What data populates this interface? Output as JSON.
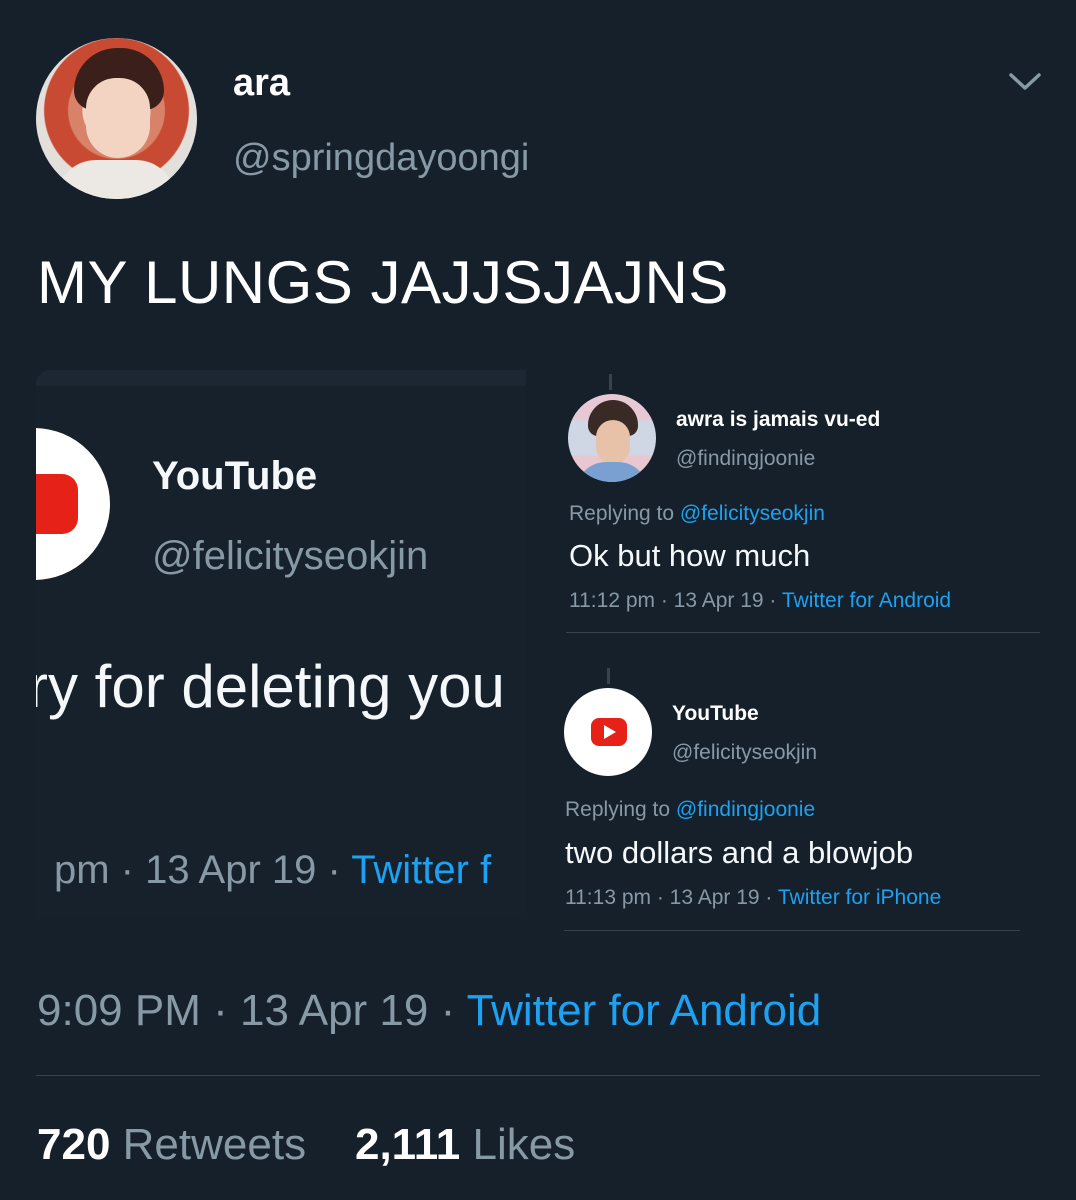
{
  "tweet": {
    "author": {
      "display_name": "ara",
      "handle": "@springdayoongi"
    },
    "text": "MY LUNGS JAJJSJAJNS",
    "menu_icon": "chevron-down-icon",
    "timestamp": {
      "time": "9:09 PM",
      "sep1": " · ",
      "date": "13 Apr 19",
      "sep2": " · ",
      "source": "Twitter for Android"
    },
    "stats": {
      "retweets_count": "720",
      "retweets_label": "Retweets",
      "likes_count": "2,111",
      "likes_label": "Likes"
    }
  },
  "left_image": {
    "name": "YouTube",
    "handle": "@felicityseokjin",
    "text": "ry for deleting you",
    "meta": {
      "prefix": "pm · 13 Apr 19 · ",
      "source": "Twitter f"
    }
  },
  "right_image": {
    "replies": [
      {
        "name": "awra is jamais vu-ed",
        "handle": "@findingjoonie",
        "replying_prefix": "Replying to ",
        "replying_to": "@felicityseokjin",
        "text": "Ok but how much",
        "meta_prefix": "11:12 pm · 13 Apr 19 · ",
        "source": "Twitter for Android"
      },
      {
        "name": "YouTube",
        "handle": "@felicityseokjin",
        "replying_prefix": "Replying to ",
        "replying_to": "@findingjoonie",
        "text": "two dollars and a blowjob",
        "meta_prefix": "11:13 pm · 13 Apr 19 · ",
        "source": "Twitter for iPhone"
      }
    ]
  },
  "colors": {
    "background": "#15202b",
    "text_primary": "#ffffff",
    "text_secondary": "#8899a6",
    "link": "#1da1f2",
    "divider": "#38444d",
    "youtube_red": "#e62117"
  }
}
